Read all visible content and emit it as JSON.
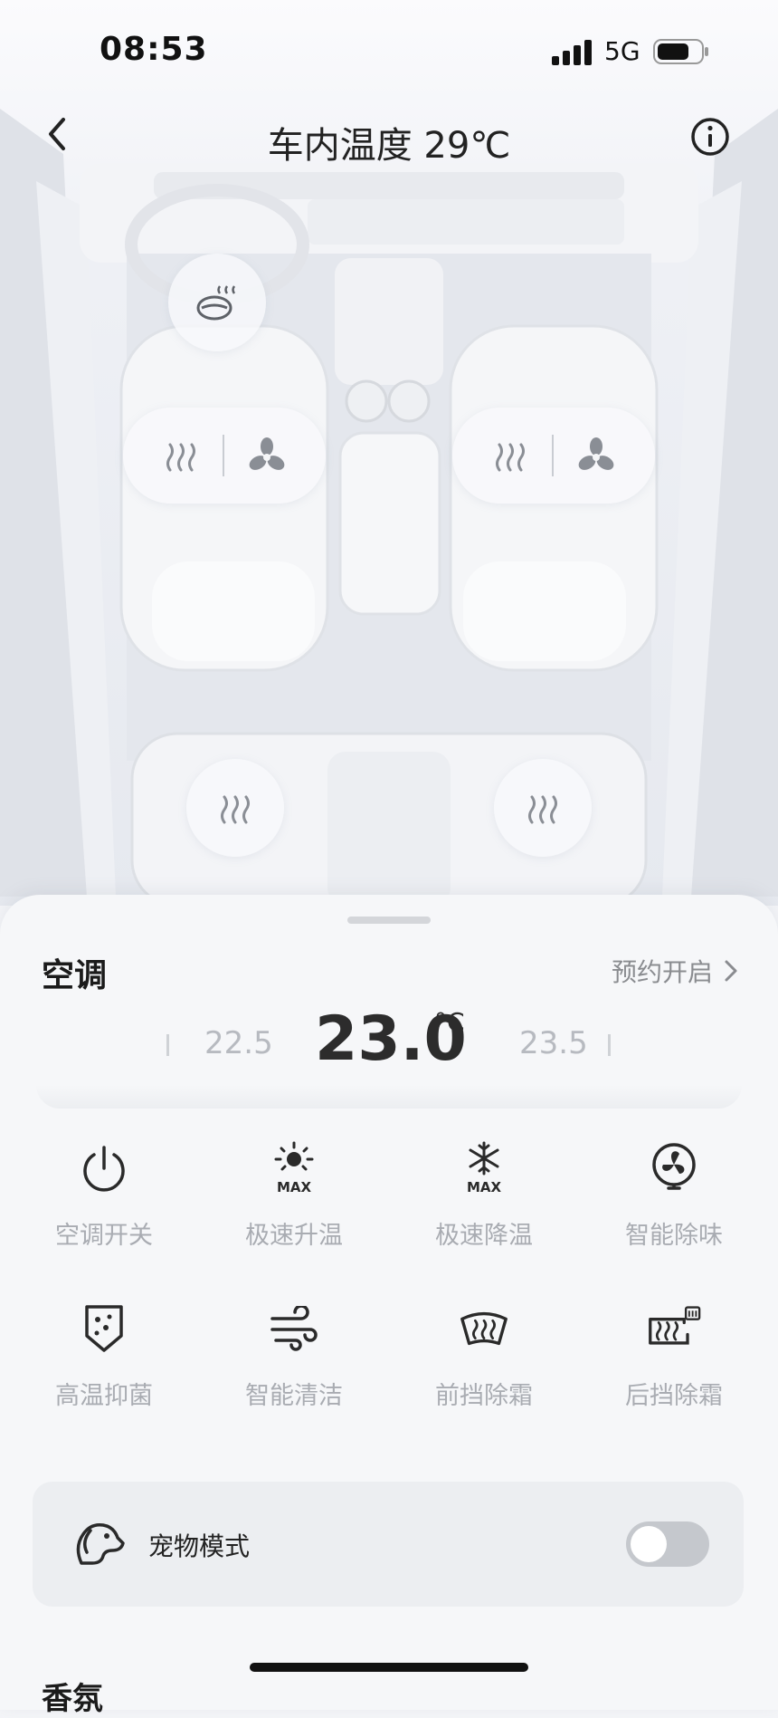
{
  "status_bar": {
    "time": "08:53",
    "network": "5G"
  },
  "nav": {
    "title": "车内温度 29℃"
  },
  "ac": {
    "section_title": "空调",
    "schedule_label": "预约开启",
    "temperature": "23.0",
    "unit": "°C",
    "prev_temp": "22.5",
    "next_temp": "23.5"
  },
  "functions": [
    {
      "label": "空调开关",
      "icon": "power-icon"
    },
    {
      "label": "极速升温",
      "icon": "max-heat-icon"
    },
    {
      "label": "极速降温",
      "icon": "max-cool-icon"
    },
    {
      "label": "智能除味",
      "icon": "fan-icon"
    },
    {
      "label": "高温抑菌",
      "icon": "sterilize-icon"
    },
    {
      "label": "智能清洁",
      "icon": "wind-clean-icon"
    },
    {
      "label": "前挡除霜",
      "icon": "front-defrost-icon"
    },
    {
      "label": "后挡除霜",
      "icon": "rear-defrost-icon"
    }
  ],
  "pet_mode": {
    "label": "宠物模式",
    "enabled": false
  },
  "next_section": {
    "title": "香氛"
  },
  "colors": {
    "label_gray": "#a9acb2",
    "toggle_off": "#c5c8cd",
    "sheet": "#f6f7f9"
  }
}
